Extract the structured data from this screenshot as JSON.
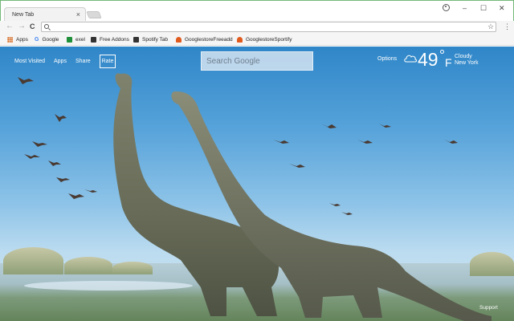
{
  "browser": {
    "tab_title": "New Tab",
    "tab_close": "×",
    "window_controls": {
      "minimize": "–",
      "maximize": "☐",
      "close": "✕"
    },
    "nav": {
      "back": "←",
      "forward": "→",
      "reload": "C"
    },
    "omnibox": {
      "value": "",
      "placeholder": ""
    },
    "star": "☆",
    "menu": "⋮"
  },
  "bookmarks": [
    {
      "label": "Apps",
      "icon": "apps-grid-icon"
    },
    {
      "label": "Google",
      "icon": "google-icon"
    },
    {
      "label": "exel",
      "icon": "sheet-icon"
    },
    {
      "label": "Free Addons",
      "icon": "addon-icon"
    },
    {
      "label": "Spotify Tab",
      "icon": "addon-icon"
    },
    {
      "label": "GooglestoreFreeadd",
      "icon": "store-icon"
    },
    {
      "label": "GooglestoreSportify",
      "icon": "store-icon"
    }
  ],
  "newtab": {
    "links": [
      "Most Visited",
      "Apps",
      "Share"
    ],
    "rate_label": "Rate",
    "search_placeholder": "Search Google",
    "options_label": "Options",
    "weather": {
      "temp": "49",
      "unit": "F",
      "condition": "Cloudy",
      "location": "New York"
    },
    "support_label": "Support"
  },
  "colors": {
    "frame_border": "#74b879",
    "sky": "#4b9bd6",
    "text_light": "#ffffff"
  }
}
